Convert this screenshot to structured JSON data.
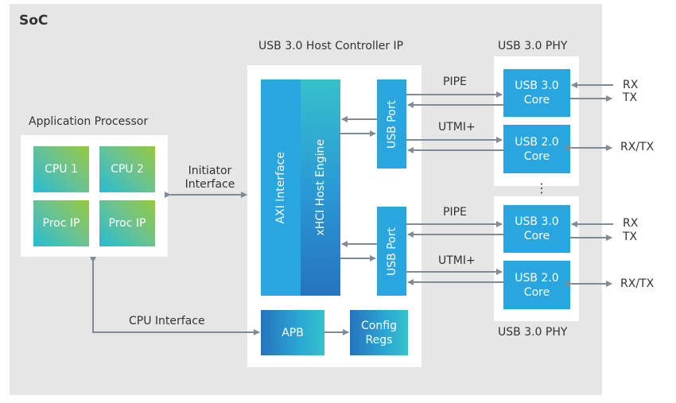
{
  "soc": {
    "title": "SoC"
  },
  "app_processor": {
    "title": "Application Processor",
    "blocks": [
      "CPU 1",
      "CPU 2",
      "Proc IP",
      "Proc IP"
    ]
  },
  "host_controller": {
    "title": "USB 3.0 Host Controller IP",
    "axi": "AXI Interface",
    "xhci": "xHCI Host Engine",
    "ports": [
      "USB Port",
      "USB Port"
    ],
    "apb": "APB",
    "config_regs": [
      "Config",
      "Regs"
    ]
  },
  "phy": {
    "top_title": "USB 3.0 PHY",
    "bottom_title": "USB 3.0 PHY",
    "ellipsis": "⋮",
    "cores": [
      {
        "line1": "USB 3.0",
        "line2": "Core"
      },
      {
        "line1": "USB 2.0",
        "line2": "Core"
      },
      {
        "line1": "USB 3.0",
        "line2": "Core"
      },
      {
        "line1": "USB 2.0",
        "line2": "Core"
      }
    ]
  },
  "interfaces": {
    "initiator": [
      "Initiator",
      "Interface"
    ],
    "cpu": "CPU Interface",
    "pipe": "PIPE",
    "utmi": "UTMI+",
    "rx": "RX",
    "tx": "TX",
    "rxtx": "RX/TX"
  },
  "colors": {
    "background": "#e6e6e6",
    "block_blue": "#29a6df",
    "arrow": "#7f8c95"
  }
}
